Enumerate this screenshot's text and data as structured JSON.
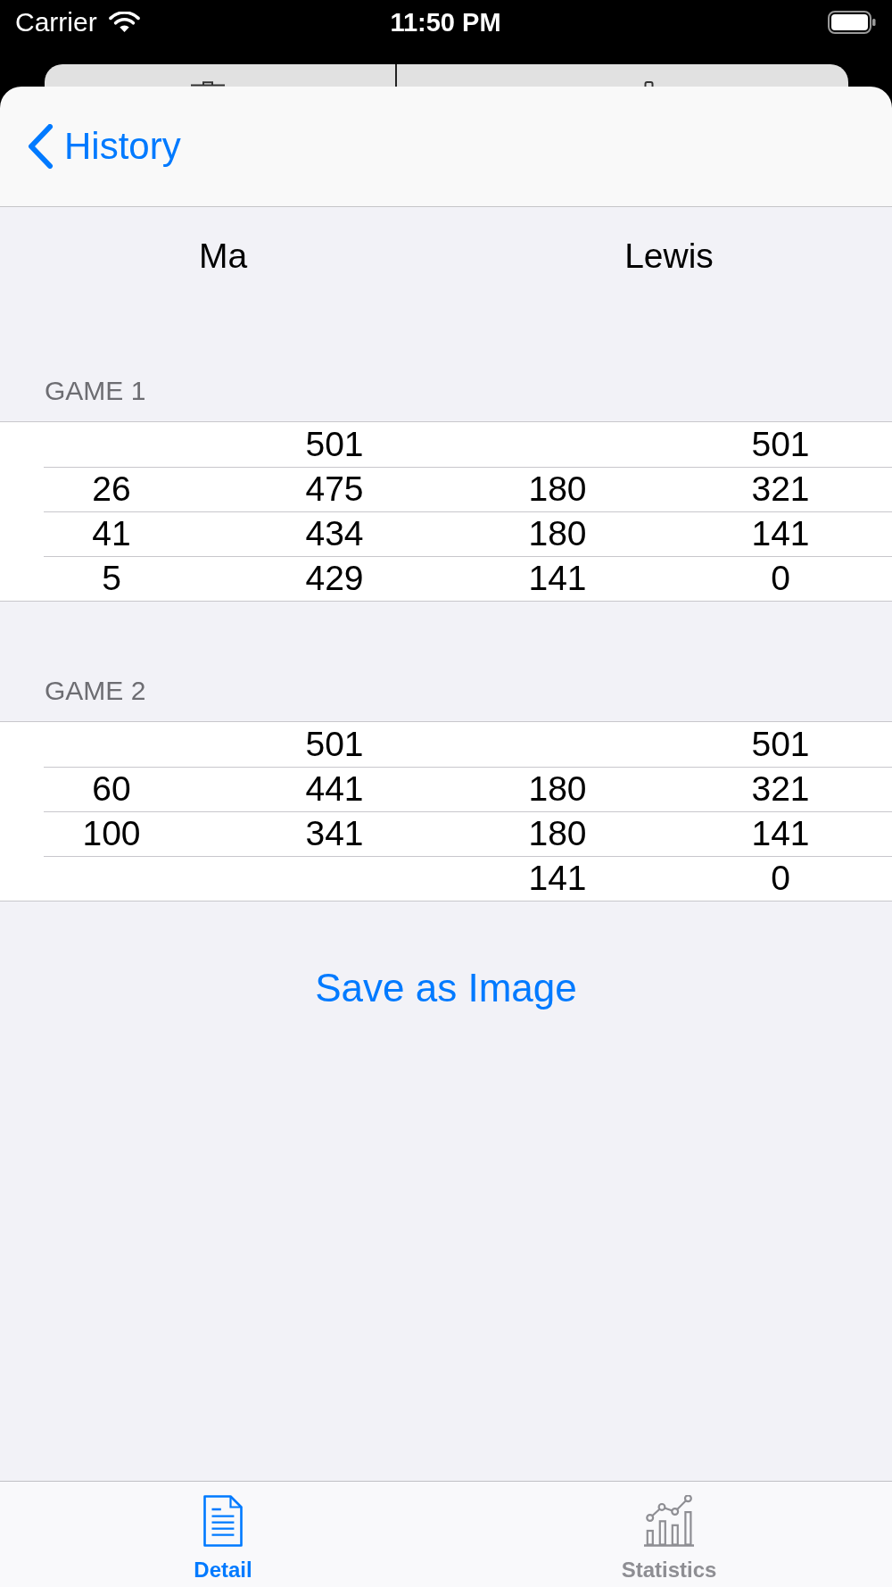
{
  "status_bar": {
    "carrier": "Carrier",
    "time": "11:50 PM"
  },
  "navigation_bar": {
    "back_label": "History"
  },
  "players": [
    {
      "name": "Ma"
    },
    {
      "name": "Lewis"
    }
  ],
  "games": [
    {
      "title": "GAME 1",
      "rows": [
        {
          "column_2": "501",
          "column_4": "501"
        },
        {
          "column_1": "26",
          "column_2": "475",
          "column_3": "180",
          "column_4": "321"
        },
        {
          "column_1": "41",
          "column_2": "434",
          "column_3": "180",
          "column_4": "141"
        },
        {
          "column_1": "5",
          "column_2": "429",
          "column_3": "141",
          "column_4": "0"
        }
      ]
    },
    {
      "title": "GAME 2",
      "rows": [
        {
          "column_2": "501",
          "column_4": "501"
        },
        {
          "column_1": "60",
          "column_2": "441",
          "column_3": "180",
          "column_4": "321"
        },
        {
          "column_1": "100",
          "column_2": "341",
          "column_3": "180",
          "column_4": "141"
        },
        {
          "column_3": "141",
          "column_4": "0"
        }
      ]
    }
  ],
  "save_button": {
    "label": "Save as Image"
  },
  "tabs": [
    {
      "label": "Detail",
      "selected": true
    },
    {
      "label": "Statistics",
      "selected": false
    }
  ]
}
